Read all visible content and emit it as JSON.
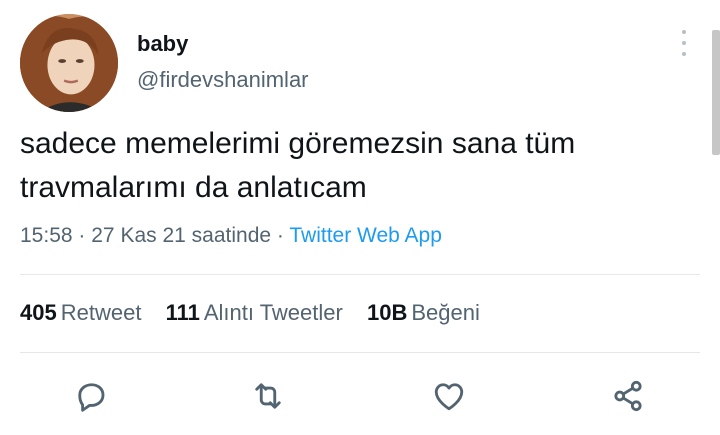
{
  "author": {
    "display_name": "baby",
    "username": "@firdevshanimlar",
    "avatar_icon": "profile-photo"
  },
  "tweet": {
    "text": "sadece memelerimi göremezsin sana tüm\ntravmalarımı da anlatıcam",
    "time": "15:58",
    "date": "27 Kas 21 saatinde",
    "separator": "·",
    "source": "Twitter Web App"
  },
  "stats": {
    "retweets": {
      "count": "405",
      "label": "Retweet"
    },
    "quotes": {
      "count": "111",
      "label": "Alıntı Tweetler"
    },
    "likes": {
      "count": "10B",
      "label": "Beğeni"
    }
  },
  "actions": [
    "reply-icon",
    "retweet-icon",
    "like-icon",
    "share-icon"
  ],
  "colors": {
    "text_primary": "#0f1419",
    "text_secondary": "#536471",
    "link": "#1d9bf0",
    "divider": "#e4e8ea"
  }
}
